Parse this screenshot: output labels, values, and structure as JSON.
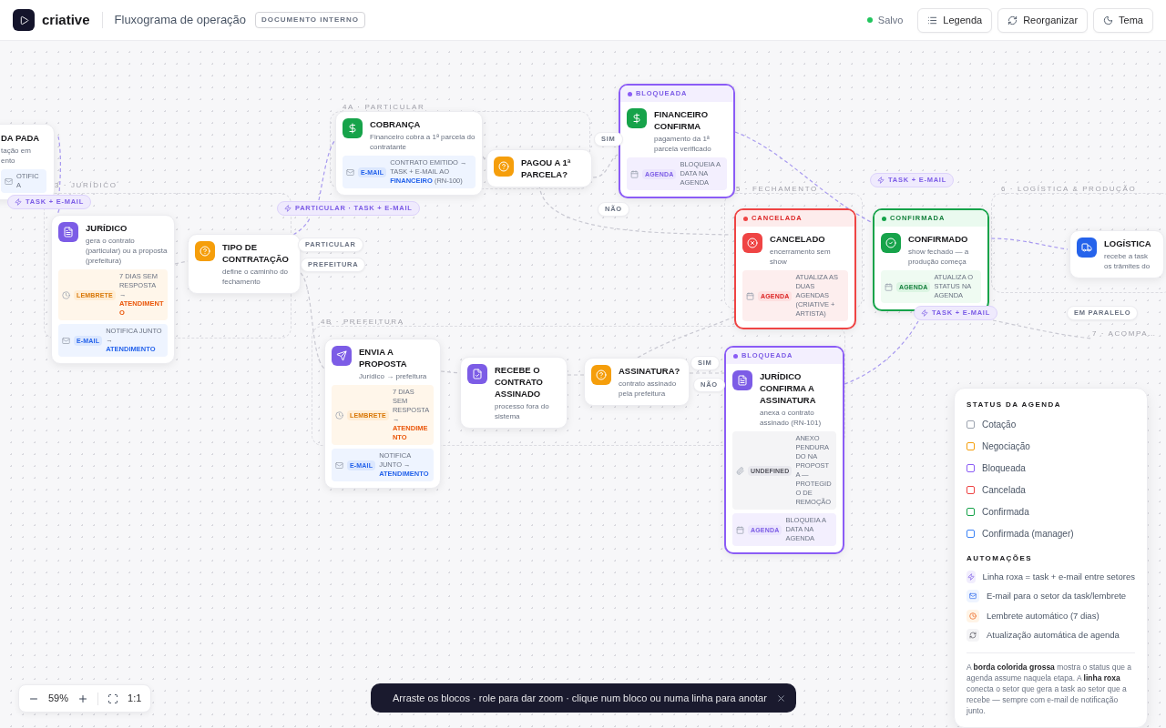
{
  "header": {
    "logo": "criative",
    "title": "Fluxograma de operação",
    "badge": "DOCUMENTO INTERNO",
    "save_status": "Salvo",
    "buttons": [
      {
        "label": "Legenda",
        "kind": "list"
      },
      {
        "label": "Reorganizar",
        "kind": "refresh"
      },
      {
        "label": "Tema",
        "kind": "moon"
      }
    ]
  },
  "lanes": [
    {
      "label": "3 · JURÍDICO"
    },
    {
      "label": "4A · PARTICULAR"
    },
    {
      "label": "4B · PREFEITURA"
    },
    {
      "label": "5 · FECHAMENTO"
    },
    {
      "label": "6 · LOGÍSTICA & PRODUÇÃO"
    },
    {
      "label": "7 · ACOMPA…"
    }
  ],
  "nodes": [
    {
      "title": "DA PADA",
      "subtitle": "tação em ento",
      "tags": [
        {
          "kind": "email",
          "text": "OTIFICA"
        }
      ]
    },
    {
      "title": "JURÍDICO",
      "subtitle": "gera o contrato (particular) ou a proposta (prefeitura)",
      "tags": [
        {
          "kind": "reminder",
          "label": "LEMBRETE",
          "text": "7 DIAS SEM RESPOSTA → **ATENDIMENTO**"
        },
        {
          "kind": "email",
          "label": "E-MAIL",
          "text": "NOTIFICA JUNTO → **ATENDIMENTO**"
        }
      ]
    },
    {
      "title": "TIPO DE CONTRATAÇÃO",
      "subtitle": "define o caminho do fechamento"
    },
    {
      "title": "COBRANÇA",
      "subtitle": "Financeiro cobra a 1ª parcela do contratante",
      "tags": [
        {
          "kind": "email",
          "label": "E-MAIL",
          "text": "CONTRATO EMITIDO → TASK + E-MAIL AO **FINANCEIRO** (RN-100)"
        }
      ]
    },
    {
      "title": "PAGOU A 1ª PARCELA?"
    },
    {
      "title": "FINANCEIRO CONFIRMA",
      "subtitle": "pagamento da 1ª parcela verificado",
      "status": {
        "label": "BLOQUEADA",
        "kind": "blocked"
      },
      "tags": [
        {
          "kind": "agenda",
          "label": "AGENDA",
          "text": "BLOQUEIA A DATA NA AGENDA"
        }
      ]
    },
    {
      "title": "ENVIA A PROPOSTA",
      "subtitle": "Jurídico → prefeitura",
      "tags": [
        {
          "kind": "reminder",
          "label": "LEMBRETE",
          "text": "7 DIAS SEM RESPOSTA → **ATENDIMENTO**"
        },
        {
          "kind": "email",
          "label": "E-MAIL",
          "text": "NOTIFICA JUNTO → **ATENDIMENTO**"
        }
      ]
    },
    {
      "title": "RECEBE O CONTRATO ASSINADO",
      "subtitle": "processo fora do sistema"
    },
    {
      "title": "ASSINATURA?",
      "subtitle": "contrato assinado pela prefeitura"
    },
    {
      "title": "CANCELADO",
      "subtitle": "encerramento sem show",
      "status": {
        "label": "CANCELADA",
        "kind": "cancelled"
      },
      "tags": [
        {
          "kind": "agenda",
          "label": "AGENDA",
          "text": "ATUALIZA AS DUAS AGENDAS (CRIATIVE + ARTISTA)"
        }
      ]
    },
    {
      "title": "CONFIRMADO",
      "subtitle": "show fechado — a produção começa",
      "status": {
        "label": "CONFIRMADA",
        "kind": "confirmed"
      },
      "tags": [
        {
          "kind": "agenda",
          "label": "AGENDA",
          "text": "ATUALIZA O STATUS NA AGENDA"
        }
      ]
    },
    {
      "title": "LOGÍSTICA",
      "subtitle": "recebe a task os trâmites do"
    },
    {
      "title": "JURÍDICO CONFIRMA A ASSINATURA",
      "subtitle": "anexa o contrato assinado (RN-101)",
      "status": {
        "label": "BLOQUEADA",
        "kind": "blocked"
      },
      "tags": [
        {
          "kind": "attach",
          "label": "UNDEFINED",
          "text": "ANEXO PENDURADO NA PROPOSTA — PROTEGIDO DE REMOÇÃO"
        },
        {
          "kind": "agenda",
          "label": "AGENDA",
          "text": "BLOQUEIA A DATA NA AGENDA"
        }
      ]
    }
  ],
  "edge_labels": [
    {
      "text": "TASK + E-MAIL",
      "kind": "automation"
    },
    {
      "text": "PARTICULAR · TASK + E-MAIL",
      "kind": "automation"
    },
    {
      "text": "PARTICULAR",
      "kind": "plain"
    },
    {
      "text": "PREFEITURA",
      "kind": "plain"
    },
    {
      "text": "SIM",
      "kind": "plain"
    },
    {
      "text": "NÃO",
      "kind": "plain"
    },
    {
      "text": "TASK + E-MAIL",
      "kind": "automation"
    },
    {
      "text": "TASK + E-MAIL",
      "kind": "automation"
    },
    {
      "text": "EM PARALELO",
      "kind": "plain"
    },
    {
      "text": "SIM",
      "kind": "plain"
    },
    {
      "text": "NÃO",
      "kind": "plain"
    }
  ],
  "legend": {
    "status_title": "STATUS DA AGENDA",
    "statuses": [
      {
        "label": "Cotação",
        "color": "#9ca3af"
      },
      {
        "label": "Negociação",
        "color": "#f59e0b"
      },
      {
        "label": "Bloqueada",
        "color": "#8b5cf6"
      },
      {
        "label": "Cancelada",
        "color": "#ef4444"
      },
      {
        "label": "Confirmada",
        "color": "#16a34a"
      },
      {
        "label": "Confirmada (manager)",
        "color": "#3b82f6"
      }
    ],
    "automations_title": "AUTOMAÇÕES",
    "automations": [
      {
        "label": "Linha roxa = task + e-mail entre setores",
        "kind": "bolt"
      },
      {
        "label": "E-mail para o setor da task/lembrete",
        "kind": "mail"
      },
      {
        "label": "Lembrete automático (7 dias)",
        "kind": "clock"
      },
      {
        "label": "Atualização automática de agenda",
        "kind": "refresh"
      }
    ],
    "note": "A **borda colorida grossa** mostra o status que a agenda assume naquela etapa. A **linha roxa** conecta o setor que gera a task ao setor que a recebe — sempre com e-mail de notificação junto."
  },
  "zoom": {
    "level": "59%",
    "reset": "1:1"
  },
  "toast": {
    "text": "Arraste os blocos · role para dar zoom · clique num bloco ou numa linha para anotar"
  }
}
